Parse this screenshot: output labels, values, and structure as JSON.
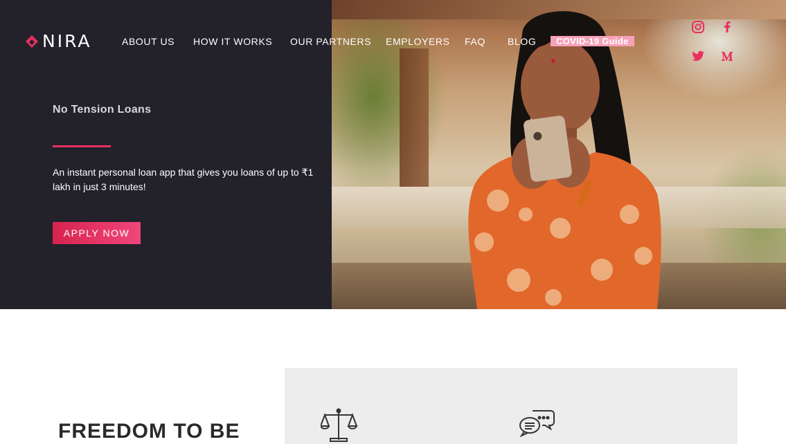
{
  "brand": {
    "name": "NIRA",
    "accent": "#e8305f",
    "dark_bg": "#23212a"
  },
  "nav": {
    "items": [
      {
        "label": "ABOUT US"
      },
      {
        "label": "HOW IT WORKS"
      },
      {
        "label": "OUR PARTNERS"
      },
      {
        "label": "EMPLOYERS"
      },
      {
        "label": "FAQ"
      },
      {
        "label": "BLOG"
      }
    ],
    "highlight": {
      "label": "COVID-19 Guide",
      "color": "#f5a1b9"
    }
  },
  "social": {
    "icons": [
      "instagram-icon",
      "facebook-icon",
      "twitter-icon",
      "medium-icon"
    ],
    "color": "#e8305f"
  },
  "hero": {
    "title": "No Tension Loans",
    "description": "An instant personal loan app that gives you loans of up to ₹1 lakh in just 3 minutes!",
    "cta": "APPLY NOW"
  },
  "section": {
    "heading": "FREEDOM TO BE",
    "feature_icons": [
      "scales-icon",
      "chat-bubbles-icon"
    ]
  }
}
